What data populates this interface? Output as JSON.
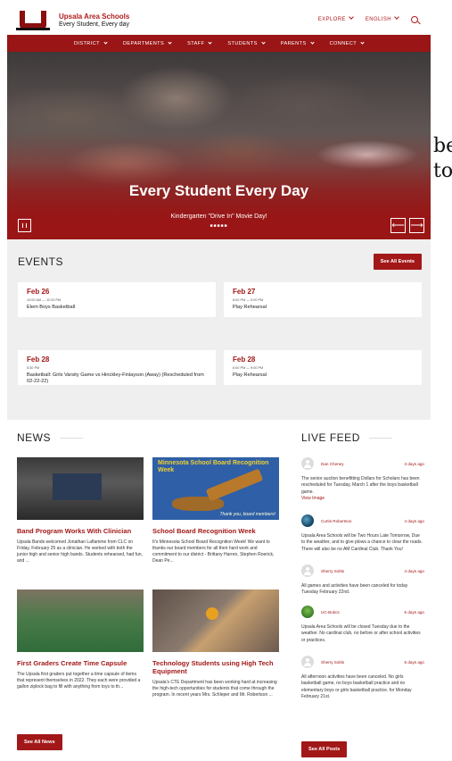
{
  "header": {
    "school_name": "Upsala Area Schools",
    "tagline": "Every Student, Every day",
    "explore_label": "EXPLORE",
    "language_label": "ENGLISH"
  },
  "nav": {
    "items": [
      {
        "label": "DISTRICT"
      },
      {
        "label": "DEPARTMENTS"
      },
      {
        "label": "STAFF"
      },
      {
        "label": "STUDENTS"
      },
      {
        "label": "PARENTS"
      },
      {
        "label": "CONNECT"
      }
    ]
  },
  "hero": {
    "headline": "Every Student Every Day",
    "caption": "Kindergarten \"Drive In\" Movie Day!",
    "dots": "■■■■■",
    "prev_glyph": "⟵",
    "next_glyph": "⟶"
  },
  "events": {
    "title": "EVENTS",
    "see_all_label": "See All Events",
    "items": [
      {
        "date": "Feb 26",
        "time": "10:00 AM — 12:00 PM",
        "name": "Elem Boys Basketball"
      },
      {
        "date": "Feb 27",
        "time": "6:00 PM — 9:00 PM",
        "name": "Play Rehearsal"
      },
      {
        "date": "Feb 28",
        "time": "5:30 PM",
        "name": "Basketball: Girls Varsity Game vs Hinckley-Finlayson (Away) (Rescheduled from 02-22-22)"
      },
      {
        "date": "Feb 28",
        "time": "6:00 PM — 9:00 PM",
        "name": "Play Rehearsal"
      }
    ]
  },
  "news": {
    "title": "NEWS",
    "see_all_label": "See All News",
    "items": [
      {
        "title": "Band Program Works With Clinician",
        "text": "Upsala Bands welcomed Jonathan Laflamme from CLC on Friday, February 25 as a clinician. He worked with both the junior high and senior high bands. Students rehearsed, had fun, and ..."
      },
      {
        "title": "School Board Recognition Week",
        "text": "It's Minnesota School Board Recognition Week! We want to thanks our board members for all their hard work and commitment to our district - Brittany Harren, Stephen Roerick, Dean Pe..."
      },
      {
        "title": "First Graders Create Time Capsule",
        "text": "The Upsala first graders put together a time capsule of items that represent themselves in 2022. They each were provided a gallon ziplock bag to fill with anything from toys to th..."
      },
      {
        "title": "Technology Students using High Tech Equipment",
        "text": "Upsala's CTE Department has been working hard at increasing the high-tech opportunities for students that come through the program. In recent years Mrs. Schleper and Mr. Robertson ..."
      }
    ],
    "board_image": {
      "heading": "Minnesota School Board Recognition Week",
      "thanks": "Thank you, board members!"
    }
  },
  "feed": {
    "title": "LIVE FEED",
    "see_all_label": "See All Posts",
    "posts": [
      {
        "author": "Dan Cheney",
        "ago": "3 days ago",
        "body": "The senior auction benefitting Dollars for Scholars has been rescheduled for Tuesday, March 1 after the boys basketball game.",
        "link": "View Image"
      },
      {
        "author": "Curtis Robertson",
        "ago": "4 days ago",
        "body": "Upsala Area Schools will be Two Hours Late Tomorrow, Due to the weather, and to give plows a chance to clear the roads. There will also be no AM Cardinal Club. Thank You!"
      },
      {
        "author": "Sherry Soltis",
        "ago": "4 days ago",
        "body": "All games and activities have been canceled for today Tuesday February 22nd."
      },
      {
        "author": "UC-Botics",
        "ago": "5 days ago",
        "body": "Upsala Area Schools will be closed Tuesday due to the weather. No cardinal club, no before or after school activities or practices."
      },
      {
        "author": "Sherry Soltis",
        "ago": "5 days ago",
        "body": "All afternoon activities have been canceled. No girls basketball game, no boys basketball practice and no elementary boys or girls basketball practice. for Monday February 21st."
      }
    ]
  },
  "background": {
    "text": "be to"
  }
}
